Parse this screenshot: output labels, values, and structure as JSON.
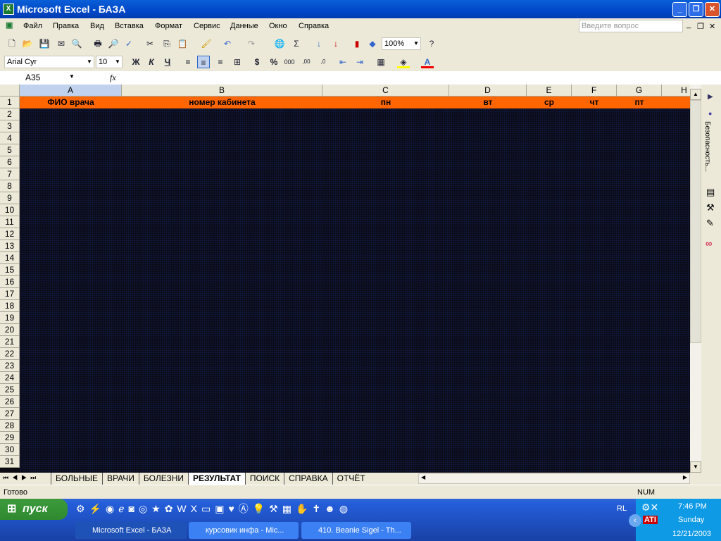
{
  "window": {
    "title": "Microsoft Excel - БАЗА"
  },
  "menu": [
    "Файл",
    "Правка",
    "Вид",
    "Вставка",
    "Формат",
    "Сервис",
    "Данные",
    "Окно",
    "Справка"
  ],
  "help_box": {
    "placeholder": "Введите вопрос"
  },
  "toolbar": {
    "zoom": "100%",
    "font": "Arial Cyr",
    "size": "10",
    "bold": "Ж",
    "italic": "К",
    "underline": "Ч"
  },
  "formula_bar": {
    "name_box": "A35",
    "fx": "fx",
    "value": ""
  },
  "columns": [
    "A",
    "B",
    "C",
    "D",
    "E",
    "F",
    "G",
    "H"
  ],
  "row1": [
    "ФИО врача",
    "номер кабинета",
    "пн",
    "вт",
    "ср",
    "чт",
    "пт",
    ""
  ],
  "rows": [
    "1",
    "2",
    "3",
    "4",
    "5",
    "6",
    "7",
    "8",
    "9",
    "10",
    "11",
    "12",
    "13",
    "14",
    "15",
    "16",
    "17",
    "18",
    "19",
    "20",
    "21",
    "22",
    "23",
    "24",
    "25",
    "26",
    "27",
    "28",
    "29",
    "30",
    "31"
  ],
  "sheet_tabs": [
    "БОЛЬНЫЕ",
    "ВРАЧИ",
    "БОЛЕЗНИ",
    "РЕЗУЛЬТАТ",
    "ПОИСК",
    "СПРАВКА",
    "ОТЧЁТ"
  ],
  "active_tab": "РЕЗУЛЬТАТ",
  "task_pane": {
    "label": "Безопасность..."
  },
  "status": {
    "text": "Готово",
    "num": "NUM"
  },
  "taskbar": {
    "start": "пуск",
    "lang": "RL",
    "tasks": [
      "Microsoft Excel - БАЗА",
      "курсовик инфа - Mic...",
      "410. Beanie Sigel - Th..."
    ],
    "time": "7:46 PM",
    "day": "Sunday",
    "date": "12/21/2003"
  },
  "colors": {
    "header_fill": "#ff6600",
    "title_bar": "#0a5fd8"
  }
}
